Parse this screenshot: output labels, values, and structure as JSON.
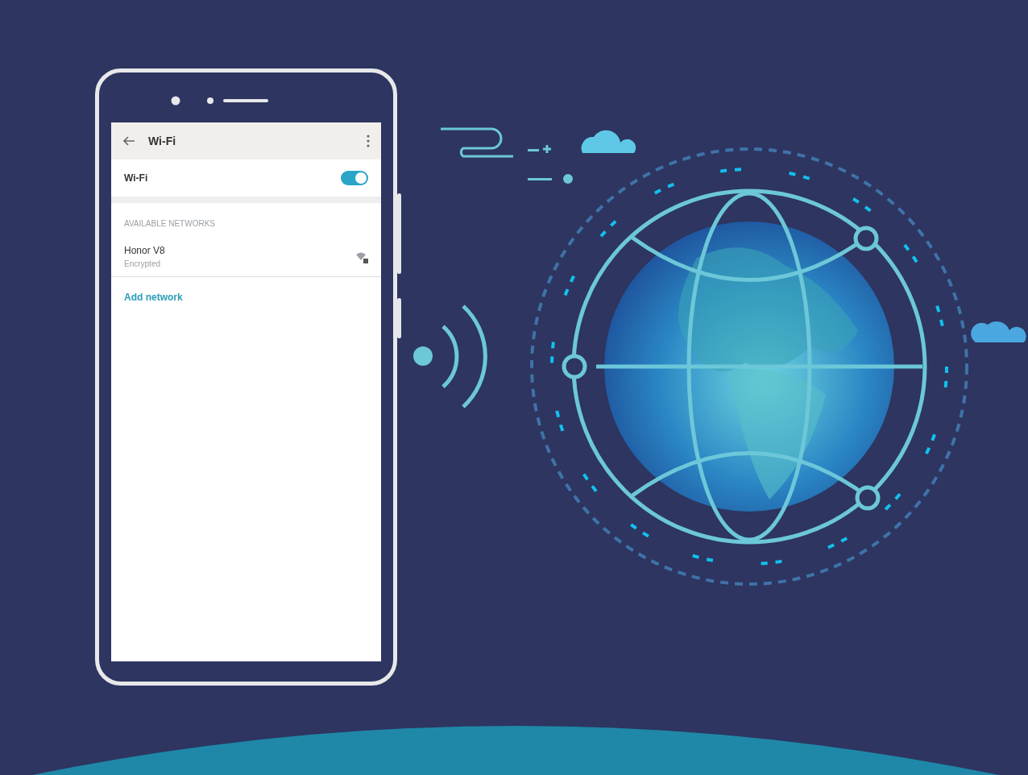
{
  "app_bar": {
    "title": "Wi-Fi"
  },
  "wifi_switch": {
    "label": "Wi-Fi",
    "on": true
  },
  "section_header": "AVAILABLE NETWORKS",
  "networks": [
    {
      "name": "Honor V8",
      "status": "Encrypted"
    }
  ],
  "add_network": "Add network"
}
